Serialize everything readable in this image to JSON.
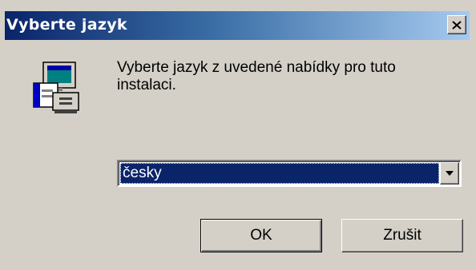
{
  "window": {
    "title": "Vyberte jazyk",
    "close_label": "×"
  },
  "message": "Vyberte jazyk z uvedené nabídky pro tuto instalaci.",
  "language_select": {
    "selected": "česky"
  },
  "buttons": {
    "ok": "OK",
    "cancel": "Zrušit"
  },
  "icons": {
    "installer": "computer-setup-icon",
    "close": "close-icon",
    "dropdown": "chevron-down-icon"
  },
  "colors": {
    "title_active": "#0a246a",
    "title_gradient_end": "#a6caf0",
    "dialog_face": "#d4d0c8",
    "selection": "#0a246a"
  }
}
